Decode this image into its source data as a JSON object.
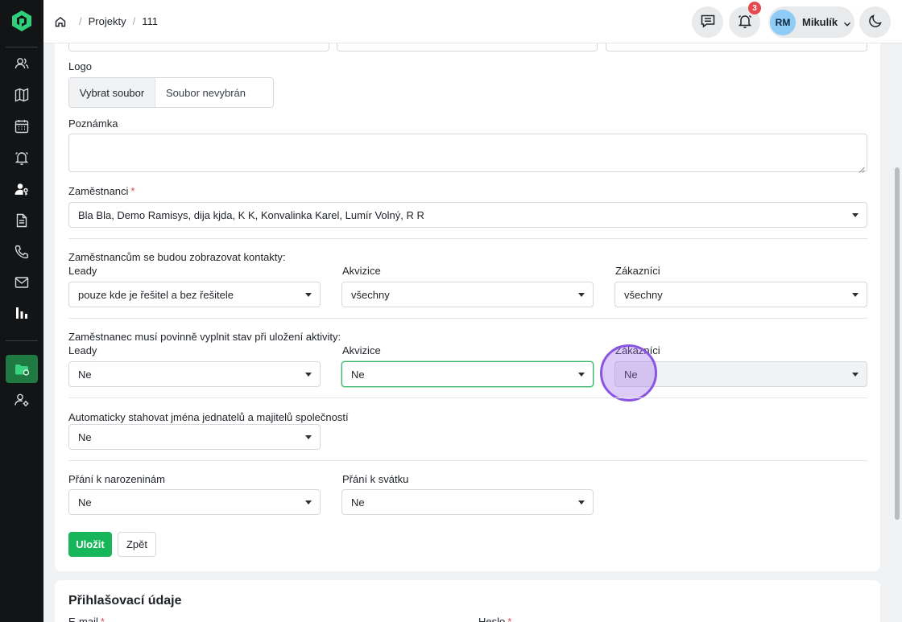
{
  "breadcrumb": {
    "items": [
      "Projekty",
      "111"
    ]
  },
  "topbar": {
    "notifications_count": "3",
    "user": {
      "initials": "RM",
      "name": "Mikulík"
    }
  },
  "form": {
    "logo": {
      "label": "Logo",
      "button": "Vybrat soubor",
      "status": "Soubor nevybrán"
    },
    "note": {
      "label": "Poznámka"
    },
    "employees": {
      "label": "Zaměstnanci",
      "required": "*",
      "value": "Bla Bla, Demo Ramisys, dija kjda, K K, Konvalinka Karel, Lumír Volný, R R"
    },
    "contacts": {
      "heading": "Zaměstnancům se budou zobrazovat kontakty:",
      "leads": {
        "label": "Leady",
        "value": "pouze kde je řešitel a bez řešitele"
      },
      "acquisitions": {
        "label": "Akvizice",
        "value": "všechny"
      },
      "customers": {
        "label": "Zákazníci",
        "value": "všechny"
      }
    },
    "status_required": {
      "heading": "Zaměstnanec musí povinně vyplnit stav při uložení aktivity:",
      "leads": {
        "label": "Leady",
        "value": "Ne"
      },
      "acquisitions": {
        "label": "Akvizice",
        "value": "Ne"
      },
      "customers": {
        "label": "Zákazníci",
        "value": "Ne"
      }
    },
    "auto_download": {
      "label": "Automaticky stahovat jména jednatelů a majitelů společností",
      "value": "Ne"
    },
    "birthday": {
      "label": "Přání k narozeninám",
      "value": "Ne"
    },
    "nameday": {
      "label": "Přání k svátku",
      "value": "Ne"
    },
    "save_label": "Uložit",
    "back_label": "Zpět"
  },
  "login_section": {
    "title": "Přihlašovací údaje",
    "email_label": "E-mail",
    "password_label": "Heslo",
    "required": "*"
  },
  "colors": {
    "accent": "#18b65a",
    "sidebar_bg": "#121416",
    "focus_ring": "#8a55e0",
    "badge": "#e5484d"
  },
  "icons": {
    "sidebar": [
      "logo-icon",
      "users-icon",
      "map-icon",
      "calendar-icon",
      "bell-icon",
      "user-key-icon",
      "document-icon",
      "phone-icon",
      "mail-icon",
      "chart-icon",
      "folder-icon",
      "user-settings-icon"
    ],
    "topbar": [
      "home-icon",
      "chat-icon",
      "bell-icon",
      "chevron-down-icon",
      "moon-icon"
    ]
  }
}
